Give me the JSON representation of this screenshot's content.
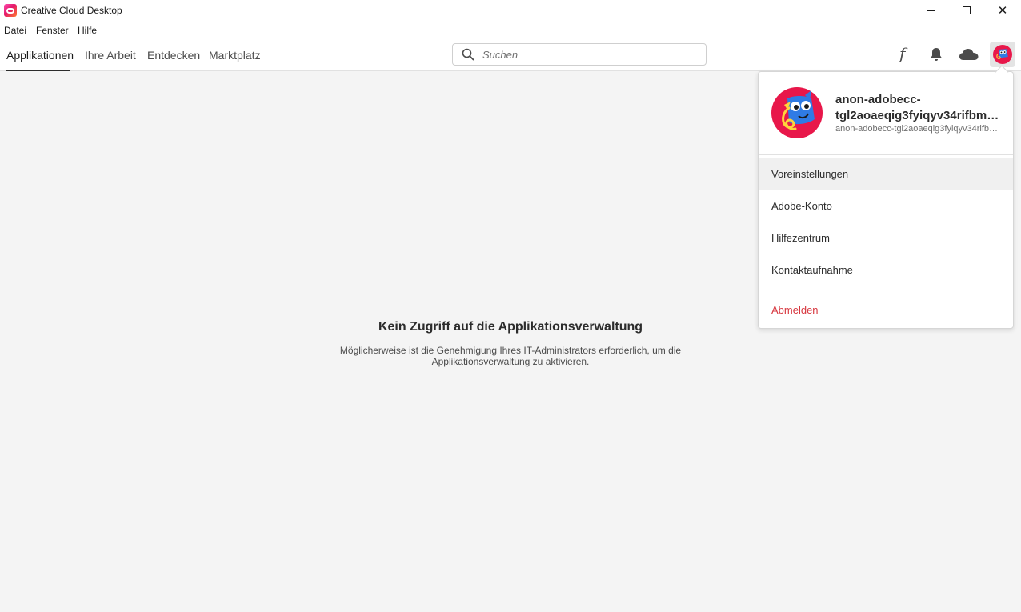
{
  "window": {
    "title": "Creative Cloud Desktop",
    "controls": {
      "minimize": "minimize-icon",
      "maximize": "maximize-icon",
      "close": "✕"
    }
  },
  "menubar": {
    "items": [
      "Datei",
      "Fenster",
      "Hilfe"
    ]
  },
  "nav": {
    "tabs": [
      "Applikationen",
      "Ihre Arbeit",
      "Entdecken",
      "Marktplatz"
    ],
    "active_tab": "Applikationen",
    "search_placeholder": "Suchen",
    "icons": {
      "fonts": "f",
      "notifications": "bell-icon",
      "cloud": "cloud-icon",
      "account": "avatar"
    }
  },
  "main": {
    "title": "Kein Zugriff auf die Applikationsverwaltung",
    "text": "Möglicherweise ist die Genehmigung Ihres IT-Administrators erforderlich, um die Applikationsverwaltung zu aktivieren."
  },
  "account_menu": {
    "name_line1": "anon-adobecc-",
    "name_line2": "tgl2aoaeqig3fyiqyv34rifbmu…",
    "email": "anon-adobecc-tgl2aoaeqig3fyiqyv34rifb…",
    "items": [
      "Voreinstellungen",
      "Adobe-Konto",
      "Hilfezentrum",
      "Kontaktaufnahme"
    ],
    "signout": "Abmelden"
  },
  "colors": {
    "accent_red": "#d7373f",
    "background": "#f4f4f4",
    "avatar_bg": "#e8174a"
  }
}
